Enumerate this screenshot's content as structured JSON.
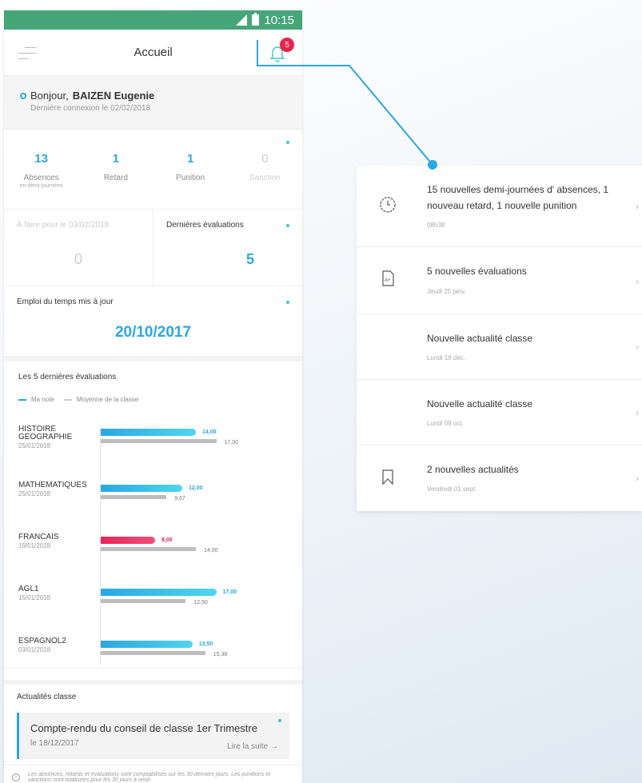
{
  "status": {
    "time": "10:15"
  },
  "appbar": {
    "title": "Accueil",
    "badge": "5"
  },
  "greeting": {
    "prefix": "Bonjour, ",
    "name": "BAIZEN Eugenie",
    "last_login": "Dernière connexion le 02/02/2018"
  },
  "stats": [
    {
      "value": "13",
      "label": "Absences",
      "sub": "en demi-journées",
      "dim": false
    },
    {
      "value": "1",
      "label": "Retard",
      "sub": "",
      "dim": false
    },
    {
      "value": "1",
      "label": "Punition",
      "sub": "",
      "dim": false
    },
    {
      "value": "0",
      "label": "Sanction",
      "sub": "",
      "dim": true
    }
  ],
  "todo": {
    "label": "À faire pour le 03/02/2018",
    "value": "0"
  },
  "last_evals": {
    "label": "Dernières évaluations",
    "value": "5"
  },
  "timetable": {
    "label": "Emploi du temps mis à jour",
    "date": "20/10/2017"
  },
  "evaluations": {
    "title": "Les 5 dernières évaluations",
    "legend": {
      "mine": "Ma note",
      "class": "Moyenne de la classe"
    },
    "colors": {
      "mine": "#2ba7e1",
      "low": "#e8235a",
      "class": "#bdbdbd"
    },
    "max": 20,
    "items": [
      {
        "subject": "HISTOIRE GEOGRAPHIE",
        "date": "25/01/2018",
        "mine": 14.0,
        "mine_label": "14,00",
        "class": 17.0,
        "class_label": "17,00",
        "low": false
      },
      {
        "subject": "MATHEMATIQUES",
        "date": "25/01/2018",
        "mine": 12.0,
        "mine_label": "12,00",
        "class": 9.67,
        "class_label": "9,67",
        "low": false
      },
      {
        "subject": "FRANCAIS",
        "date": "19/01/2018",
        "mine": 8.0,
        "mine_label": "8,00",
        "class": 14.0,
        "class_label": "14,00",
        "low": true
      },
      {
        "subject": "AGL1",
        "date": "15/01/2018",
        "mine": 17.0,
        "mine_label": "17,00",
        "class": 12.5,
        "class_label": "12,50",
        "low": false
      },
      {
        "subject": "ESPAGNOL2",
        "date": "03/01/2018",
        "mine": 13.5,
        "mine_label": "13,50",
        "class": 15.38,
        "class_label": "15,38",
        "low": false
      }
    ]
  },
  "news": {
    "title": "Actualités classe",
    "card_title": "Compte-rendu du conseil de classe 1er Trimestre",
    "card_date": "le 18/12/2017",
    "card_more": "Lire la suite →"
  },
  "footnote": "Les absences, retards et évaluations sont comptabilisés sur les 30 derniers jours. Les punitions et sanctions sont totalisées pour les 30 jours à venir.",
  "notifications": [
    {
      "icon": "clock-icon",
      "title": "15 nouvelles demi-journées d' absences, 1 nouveau retard, 1 nouvelle punition",
      "date": "08h38"
    },
    {
      "icon": "grade-document-icon",
      "title": "5 nouvelles évaluations",
      "date": "Jeudi 25 janv."
    },
    {
      "icon": "",
      "title": "Nouvelle actualité classe",
      "date": "Lundi 18 déc."
    },
    {
      "icon": "",
      "title": "Nouvelle actualité classe",
      "date": "Lundi 09 oct."
    },
    {
      "icon": "bookmark-icon",
      "title": "2 nouvelles actualités",
      "date": "Vendredi 01 sept."
    }
  ]
}
